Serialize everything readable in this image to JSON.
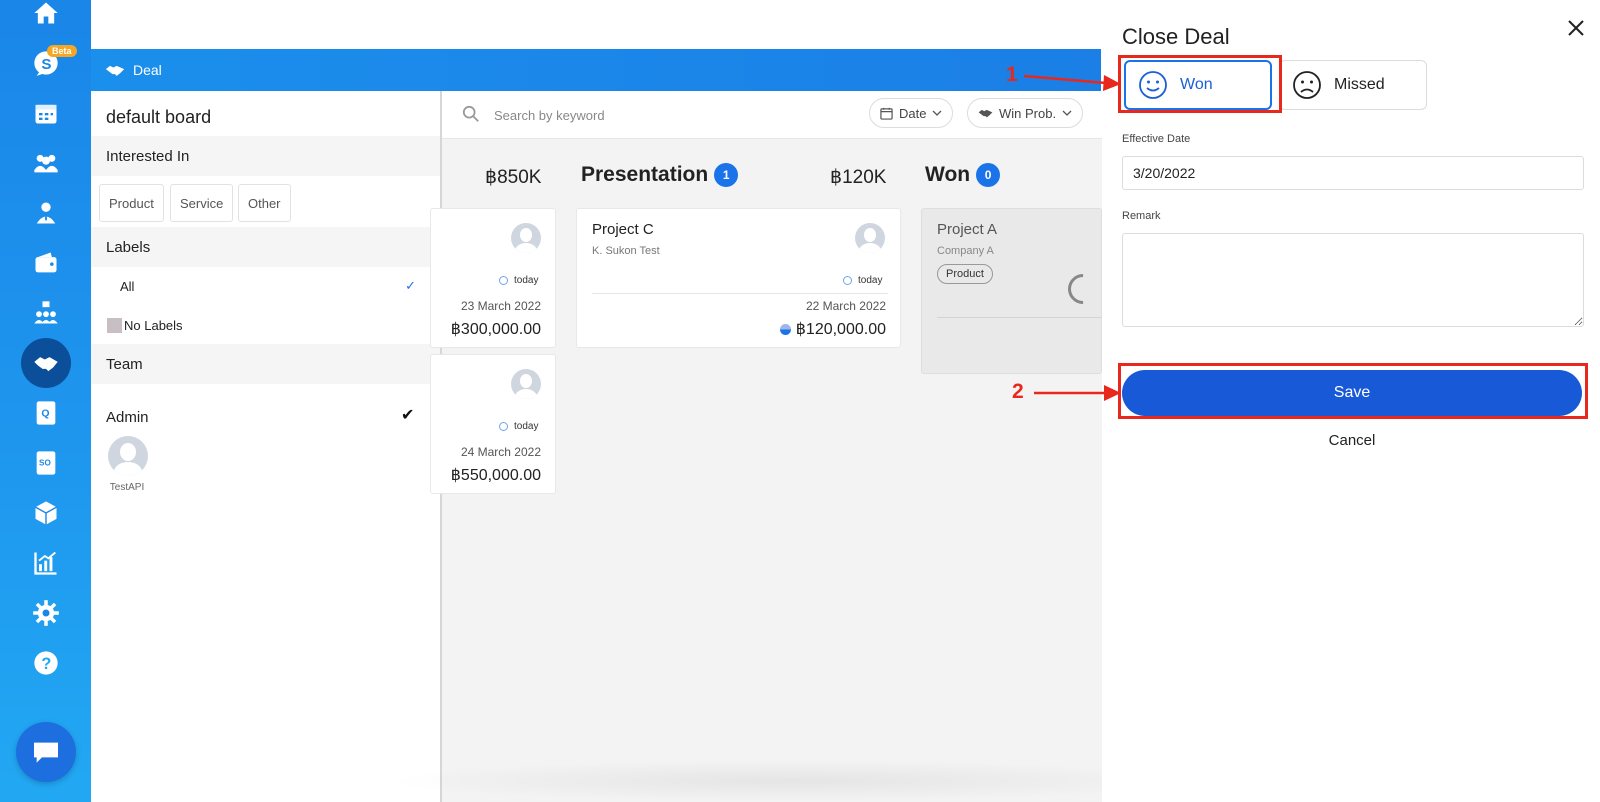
{
  "rail": {
    "beta_badge": "Beta",
    "items": [
      "home-icon",
      "chat-icon",
      "calendar-icon",
      "contacts-icon",
      "person-icon",
      "wallet-icon",
      "team-icon",
      "deal-icon",
      "quotation-icon",
      "sales-order-icon",
      "product-box-icon",
      "report-icon",
      "settings-icon",
      "help-icon"
    ],
    "active_item": "deal-icon",
    "accent_color": "#1a86e8"
  },
  "header": {
    "title": "Deal"
  },
  "filters": {
    "board_title": "default board",
    "interested_in": {
      "heading": "Interested In",
      "chips": [
        "Product",
        "Service",
        "Other"
      ]
    },
    "labels": {
      "heading": "Labels",
      "items": [
        {
          "label": "All",
          "checked": true
        },
        {
          "label": "No Labels",
          "swatch_color": "#c7bfc4"
        }
      ]
    },
    "team": {
      "heading": "Team",
      "group": "Admin",
      "members": [
        {
          "name": "TestAPI"
        }
      ]
    }
  },
  "toolbar": {
    "search_placeholder": "Search by keyword",
    "date_label": "Date",
    "winprob_label": "Win Prob."
  },
  "board": {
    "columns": [
      {
        "name": "",
        "total": "฿850K",
        "cards": [
          {
            "due": "today",
            "date": "23 March 2022",
            "amount": "฿300,000.00"
          },
          {
            "due": "today",
            "date": "24 March 2022",
            "amount": "฿550,000.00"
          }
        ]
      },
      {
        "name": "Presentation",
        "count": "1",
        "total": "฿120K",
        "cards": [
          {
            "title": "Project C",
            "subtitle": "K. Sukon Test",
            "due": "today",
            "date": "22 March 2022",
            "amount": "฿120,000.00"
          }
        ]
      },
      {
        "name": "Won",
        "count": "0",
        "cards": [
          {
            "title": "Project A",
            "subtitle": "Company A",
            "tag": "Product"
          }
        ]
      }
    ]
  },
  "close_deal": {
    "title": "Close Deal",
    "won_label": "Won",
    "missed_label": "Missed",
    "selected": "Won",
    "effective_date_label": "Effective Date",
    "effective_date_value": "3/20/2022",
    "remark_label": "Remark",
    "remark_value": "",
    "save_label": "Save",
    "cancel_label": "Cancel",
    "primary_color": "#1759d6"
  },
  "annotations": {
    "step1": "1",
    "step2": "2",
    "color": "#e8281c"
  }
}
